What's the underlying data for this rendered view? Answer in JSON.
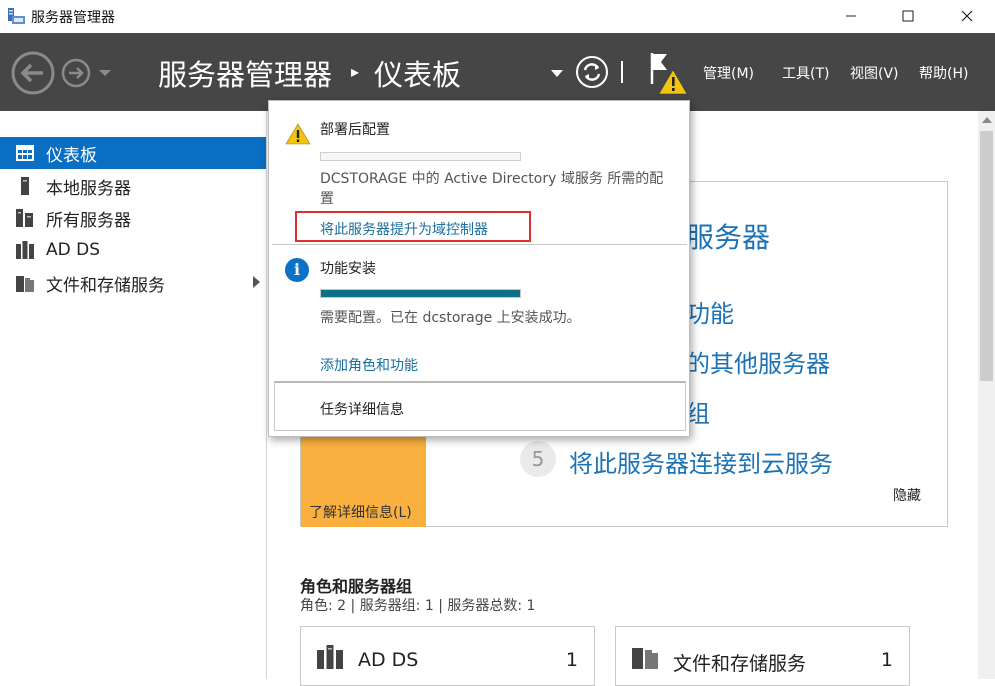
{
  "window": {
    "title": "服务器管理器",
    "icon": "server-manager-icon"
  },
  "header": {
    "breadcrumb_root": "服务器管理器",
    "breadcrumb_separator": "▸",
    "breadcrumb_current": "仪表板",
    "menus": [
      "管理(M)",
      "工具(T)",
      "视图(V)",
      "帮助(H)"
    ]
  },
  "sidebar": {
    "items": [
      {
        "label": "仪表板",
        "icon": "dashboard-icon",
        "active": true
      },
      {
        "label": "本地服务器",
        "icon": "local-server-icon"
      },
      {
        "label": "所有服务器",
        "icon": "all-servers-icon"
      },
      {
        "label": "AD DS",
        "icon": "ad-ds-icon"
      },
      {
        "label": "文件和存储服务",
        "icon": "file-storage-icon",
        "has_submenu": true
      }
    ]
  },
  "welcome": {
    "line1": "服务器",
    "line2": "功能",
    "line3": "的其他服务器",
    "line4": "组",
    "step5_number": "5",
    "step5_text": "将此服务器连接到云服务",
    "learn_more": "了解详细信息(L)",
    "hide": "隐藏"
  },
  "roles": {
    "title": "角色和服务器组",
    "summary": "角色: 2 | 服务器组: 1 | 服务器总数: 1",
    "tiles": [
      {
        "name": "AD DS",
        "count": "1",
        "icon": "ad-ds-icon"
      },
      {
        "name": "文件和存储服务",
        "count": "1",
        "icon": "file-storage-icon"
      }
    ]
  },
  "notifications": {
    "post_deploy": {
      "title": "部署后配置",
      "description": "DCSTORAGE 中的 Active Directory 域服务 所需的配置",
      "link": "将此服务器提升为域控制器",
      "progress_percent": 0
    },
    "feature_install": {
      "title": "功能安装",
      "description": "需要配置。已在 dcstorage 上安装成功。",
      "link": "添加角色和功能",
      "progress_percent": 100
    },
    "task_details": "任务详细信息"
  },
  "colors": {
    "header_bg": "#464646",
    "accent": "#0a6fc2",
    "link": "#1a6f9e",
    "tile_orange": "#f9b03f",
    "highlight_red": "#e0302d",
    "progress_fill": "#0e6f86"
  }
}
